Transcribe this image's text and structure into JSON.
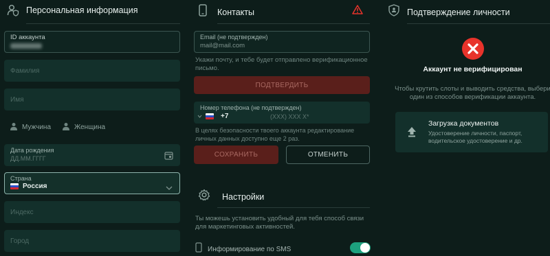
{
  "personal": {
    "title": "Персональная информация",
    "account_id_label": "ID аккаунта",
    "surname_placeholder": "Фамилия",
    "name_placeholder": "Имя",
    "gender_male": "Мужчина",
    "gender_female": "Женщина",
    "birthdate_label": "Дата рождения",
    "birthdate_placeholder": "ДД.ММ.ГГГГ",
    "country_label": "Страна",
    "country_value": "Россия",
    "index_placeholder": "Индекс",
    "city_placeholder": "Город"
  },
  "contacts": {
    "title": "Контакты",
    "email_label": "Email (не подтвержден)",
    "email_placeholder": "mail@mail.com",
    "email_note": "Укажи почту, и тебе будет отправлено верификационное письмо.",
    "confirm_button": "ПОДТВЕРДИТЬ",
    "phone_label": "Номер телефона (не подтвержден)",
    "phone_code": "+7",
    "phone_placeholder": "(XXX) XXX X*",
    "phone_note": "В целях безопасности твоего аккаунта редактирование личных данных доступно еще 2 раз.",
    "save_button": "СОХРАНИТЬ",
    "cancel_button": "ОТМЕНИТЬ"
  },
  "settings": {
    "title": "Настройки",
    "note": "Ты можешь установить удобный для тебя способ связи для маркетинговых активностей.",
    "sms_label": "Информирование по SMS",
    "sms_enabled": true
  },
  "verification": {
    "title": "Подтверждение личности",
    "status": "Аккаунт не верифицирован",
    "description": "Чтобы крутить слоты и выводить средства, выбери один из способов верификации аккаунта.",
    "upload_title": "Загрузка документов",
    "upload_desc": "Удостоверение личности, паспорт, водительское удостоверение и др."
  },
  "colors": {
    "background": "#0d1d1a",
    "field": "#13302b",
    "accent_red": "#e8332b",
    "accent_green": "#1da07e",
    "button_red": "#5a1f1b"
  },
  "icons": [
    "user-shield-icon",
    "phone-icon",
    "warning-icon",
    "shield-icon",
    "user-icon",
    "calendar-icon",
    "chevron-down-icon",
    "gear-icon",
    "close-icon",
    "upload-icon"
  ]
}
